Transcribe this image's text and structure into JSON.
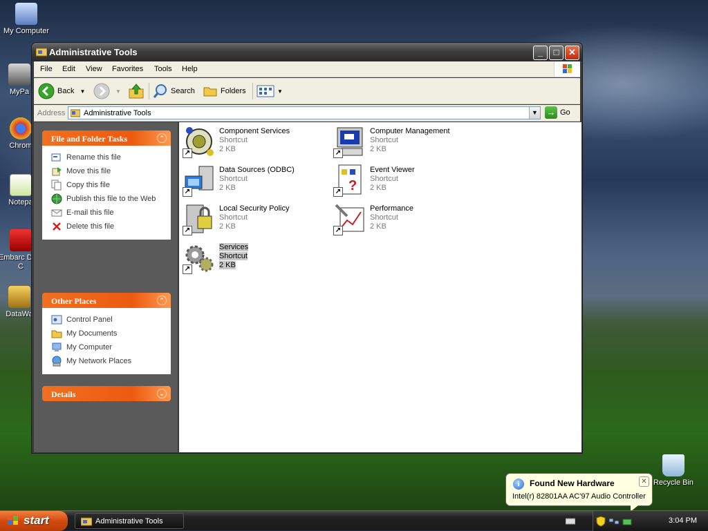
{
  "desktop": {
    "icons": [
      {
        "label": "My Computer"
      },
      {
        "label": "MyPa"
      },
      {
        "label": "Chrom"
      },
      {
        "label": "Notepa"
      },
      {
        "label": "Embarc Dev-C"
      },
      {
        "label": "DataWa"
      },
      {
        "label": "Recycle Bin"
      }
    ]
  },
  "window": {
    "title": "Administrative Tools",
    "controls": {
      "minimize": "_",
      "maximize": "□",
      "close": "✕"
    }
  },
  "menubar": {
    "items": [
      "File",
      "Edit",
      "View",
      "Favorites",
      "Tools",
      "Help"
    ]
  },
  "toolbar": {
    "back": "Back",
    "search": "Search",
    "folders": "Folders"
  },
  "address": {
    "label": "Address",
    "value": "Administrative Tools",
    "go": "Go"
  },
  "tasks": {
    "file_folder": {
      "title": "File and Folder Tasks",
      "items": [
        {
          "label": "Rename this file",
          "icon": "rename-icon"
        },
        {
          "label": "Move this file",
          "icon": "move-icon"
        },
        {
          "label": "Copy this file",
          "icon": "copy-icon"
        },
        {
          "label": "Publish this file to the Web",
          "icon": "globe-icon"
        },
        {
          "label": "E-mail this file",
          "icon": "mail-icon"
        },
        {
          "label": "Delete this file",
          "icon": "delete-icon"
        }
      ]
    },
    "other_places": {
      "title": "Other Places",
      "items": [
        {
          "label": "Control Panel",
          "icon": "control-panel-icon"
        },
        {
          "label": "My Documents",
          "icon": "folder-icon"
        },
        {
          "label": "My Computer",
          "icon": "computer-icon"
        },
        {
          "label": "My Network Places",
          "icon": "network-icon"
        }
      ]
    },
    "details": {
      "title": "Details"
    }
  },
  "files": [
    {
      "name": "Component Services",
      "type": "Shortcut",
      "size": "2 KB",
      "icon": "component-services-icon"
    },
    {
      "name": "Computer Management",
      "type": "Shortcut",
      "size": "2 KB",
      "icon": "computer-management-icon"
    },
    {
      "name": "Data Sources (ODBC)",
      "type": "Shortcut",
      "size": "2 KB",
      "icon": "data-sources-icon"
    },
    {
      "name": "Event Viewer",
      "type": "Shortcut",
      "size": "2 KB",
      "icon": "event-viewer-icon"
    },
    {
      "name": "Local Security Policy",
      "type": "Shortcut",
      "size": "2 KB",
      "icon": "security-policy-icon"
    },
    {
      "name": "Performance",
      "type": "Shortcut",
      "size": "2 KB",
      "icon": "performance-icon"
    },
    {
      "name": "Services",
      "type": "Shortcut",
      "size": "2 KB",
      "icon": "services-icon",
      "selected": true
    }
  ],
  "balloon": {
    "title": "Found New Hardware",
    "message": "Intel(r) 82801AA AC'97 Audio Controller"
  },
  "taskbar": {
    "start": "start",
    "task": "Administrative Tools",
    "clock": "3:04 PM"
  }
}
